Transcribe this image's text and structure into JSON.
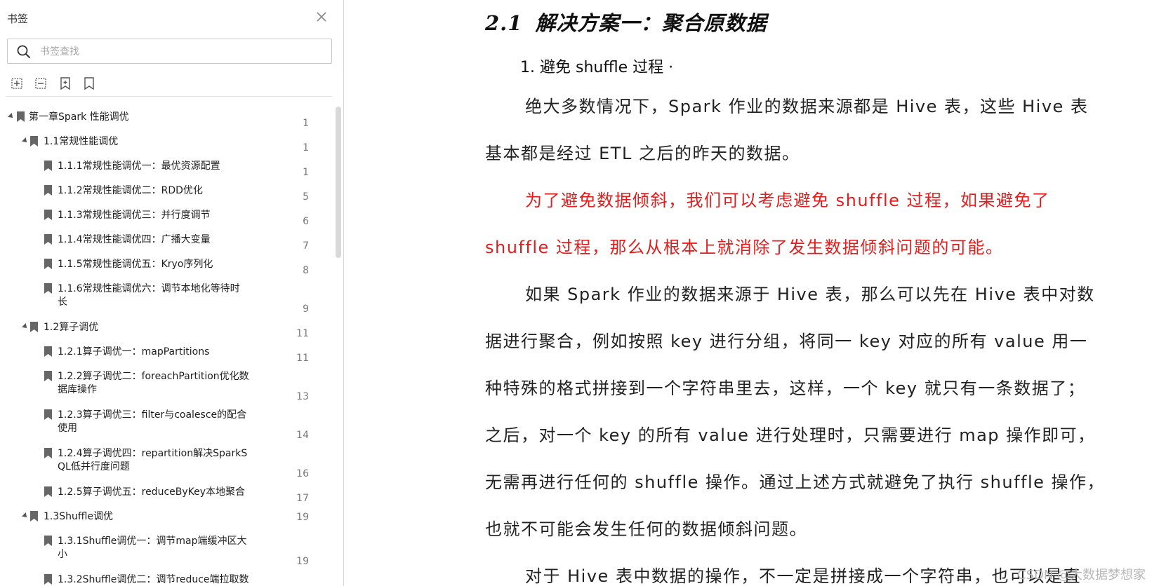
{
  "sidebar": {
    "title": "书签",
    "search_placeholder": "书签查找",
    "items": [
      {
        "label": "第一章Spark 性能调优",
        "page": "1"
      },
      {
        "label": "1.1常规性能调优",
        "page": "1"
      },
      {
        "label": "1.1.1常规性能调优一：最优资源配置",
        "page": "1"
      },
      {
        "label": "1.1.2常规性能调优二：RDD优化",
        "page": "5"
      },
      {
        "label": "1.1.3常规性能调优三：并行度调节",
        "page": "6"
      },
      {
        "label": "1.1.4常规性能调优四：广播大变量",
        "page": "7"
      },
      {
        "label": "1.1.5常规性能调优五：Kryo序列化",
        "page": "8"
      },
      {
        "label": "1.1.6常规性能调优六：调节本地化等待时\n长",
        "page": "9"
      },
      {
        "label": "1.2算子调优",
        "page": "11"
      },
      {
        "label": "1.2.1算子调优一：mapPartitions",
        "page": "11"
      },
      {
        "label": "1.2.2算子调优二：foreachPartition优化数\n据库操作",
        "page": "13"
      },
      {
        "label": "1.2.3算子调优三：filter与coalesce的配合\n使用",
        "page": "14"
      },
      {
        "label": "1.2.4算子调优四：repartition解决SparkS\nQL低并行度问题",
        "page": "16"
      },
      {
        "label": "1.2.5算子调优五：reduceByKey本地聚合",
        "page": "17"
      },
      {
        "label": "1.3Shuffle调优",
        "page": "19"
      },
      {
        "label": "1.3.1Shuffle调优一：调节map端缓冲区大\n小",
        "page": "19"
      },
      {
        "label": "1.3.2Shuffle调优二：调节reduce端拉取数",
        "page": ""
      }
    ]
  },
  "document": {
    "heading_number": "2.1",
    "heading_text": "解决方案一：聚合原数据",
    "list_item": "1.  避免 shuffle 过程 ·",
    "lines": [
      "绝大多数情况下，Spark 作业的数据来源都是 Hive 表，这些 Hive 表",
      "基本都是经过 ETL 之后的昨天的数据。",
      "为了避免数据倾斜，我们可以考虑避免 shuffle 过程，如果避免了",
      "shuffle 过程，那么从根本上就消除了发生数据倾斜问题的可能。",
      "如果 Spark 作业的数据来源于 Hive 表，那么可以先在 Hive 表中对数",
      "据进行聚合，例如按照 key 进行分组，将同一 key 对应的所有 value 用一",
      "种特殊的格式拼接到一个字符串里去，这样，一个 key 就只有一条数据了；",
      "之后，对一个 key 的所有 value 进行处理时，只需要进行 map 操作即可，",
      "无需再进行任何的 shuffle 操作。通过上述方式就避免了执行 shuffle 操作，",
      "也就不可能会发生任何的数据倾斜问题。",
      "对于 Hive 表中数据的操作，不一定是拼接成一个字符串，也可以是直"
    ],
    "highlight_color": "#e31c1c",
    "watermark": "CSDN @大数据梦想家"
  }
}
